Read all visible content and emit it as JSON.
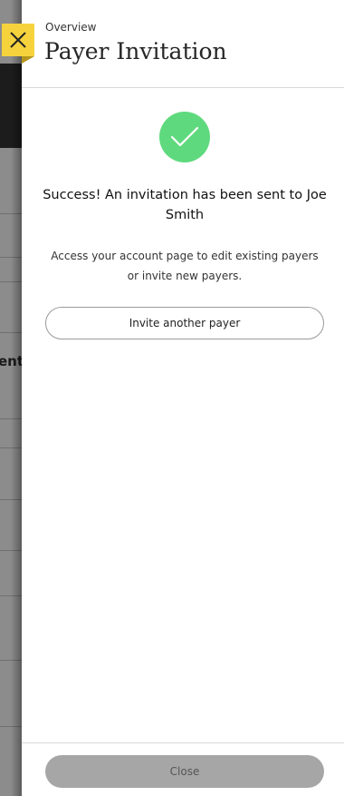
{
  "background": {
    "partial_text": "ent"
  },
  "panel": {
    "overline": "Overview",
    "title": "Payer Invitation",
    "close_icon": "close-icon",
    "success_icon": "checkmark-icon",
    "success_message": "Success! An invitation has been sent to Joe Smith",
    "info_text": "Access your account page to edit existing payers or invite new payers.",
    "invite_button_label": "Invite another payer",
    "close_button_label": "Close"
  },
  "colors": {
    "accent_yellow": "#f6d33d",
    "success_green": "#5fd97e",
    "disabled_button": "#a6a6a6"
  }
}
